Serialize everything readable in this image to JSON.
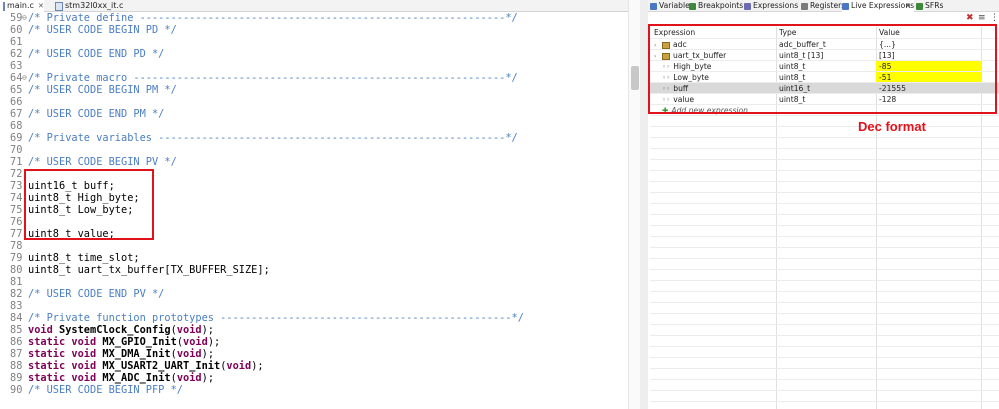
{
  "editor": {
    "tabs": [
      {
        "label": "main.c"
      },
      {
        "label": "stm32l0xx_it.c"
      }
    ],
    "lines": [
      {
        "n": "59",
        "fold": "⊖",
        "parts": [
          [
            "c",
            "/* Private define -----------------------------------------------------------*/"
          ]
        ]
      },
      {
        "n": "60",
        "fold": "",
        "parts": [
          [
            "c",
            "/* USER CODE BEGIN PD */"
          ]
        ]
      },
      {
        "n": "61",
        "fold": "",
        "parts": []
      },
      {
        "n": "62",
        "fold": "",
        "parts": [
          [
            "c",
            "/* USER CODE END PD */"
          ]
        ]
      },
      {
        "n": "63",
        "fold": "",
        "parts": []
      },
      {
        "n": "64",
        "fold": "⊖",
        "parts": [
          [
            "c",
            "/* Private macro ------------------------------------------------------------*/"
          ]
        ]
      },
      {
        "n": "65",
        "fold": "",
        "parts": [
          [
            "c",
            "/* USER CODE BEGIN PM */"
          ]
        ]
      },
      {
        "n": "66",
        "fold": "",
        "parts": []
      },
      {
        "n": "67",
        "fold": "",
        "parts": [
          [
            "c",
            "/* USER CODE END PM */"
          ]
        ]
      },
      {
        "n": "68",
        "fold": "",
        "parts": []
      },
      {
        "n": "69",
        "fold": "",
        "parts": [
          [
            "c",
            "/* Private variables --------------------------------------------------------*/"
          ]
        ]
      },
      {
        "n": "70",
        "fold": "",
        "parts": []
      },
      {
        "n": "71",
        "fold": "",
        "parts": [
          [
            "c",
            "/* USER CODE BEGIN PV */"
          ]
        ]
      },
      {
        "n": "72",
        "fold": "",
        "parts": []
      },
      {
        "n": "73",
        "fold": "",
        "parts": [
          [
            "t",
            "uint16_t buff;"
          ]
        ]
      },
      {
        "n": "74",
        "fold": "",
        "parts": [
          [
            "t",
            "uint8_t High_byte;"
          ]
        ]
      },
      {
        "n": "75",
        "fold": "",
        "parts": [
          [
            "t",
            "uint8_t Low_byte;"
          ]
        ]
      },
      {
        "n": "76",
        "fold": "",
        "parts": []
      },
      {
        "n": "77",
        "fold": "",
        "parts": [
          [
            "t",
            "uint8_t value;"
          ]
        ]
      },
      {
        "n": "78",
        "fold": "",
        "parts": []
      },
      {
        "n": "79",
        "fold": "",
        "parts": [
          [
            "t",
            "uint8_t time_slot;"
          ]
        ]
      },
      {
        "n": "80",
        "fold": "",
        "parts": [
          [
            "t",
            "uint8_t uart_tx_buffer[TX_BUFFER_SIZE];"
          ]
        ]
      },
      {
        "n": "81",
        "fold": "",
        "parts": []
      },
      {
        "n": "82",
        "fold": "",
        "parts": [
          [
            "c",
            "/* USER CODE END PV */"
          ]
        ]
      },
      {
        "n": "83",
        "fold": "",
        "parts": []
      },
      {
        "n": "84",
        "fold": "",
        "parts": [
          [
            "c",
            "/* Private function prototypes -----------------------------------------------*/"
          ]
        ]
      },
      {
        "n": "85",
        "fold": "",
        "parts": [
          [
            "k",
            "void "
          ],
          [
            "b",
            "SystemClock_Config"
          ],
          [
            "t",
            "("
          ],
          [
            "k",
            "void"
          ],
          [
            "t",
            ");"
          ]
        ]
      },
      {
        "n": "86",
        "fold": "",
        "parts": [
          [
            "k",
            "static void "
          ],
          [
            "b",
            "MX_GPIO_Init"
          ],
          [
            "t",
            "("
          ],
          [
            "k",
            "void"
          ],
          [
            "t",
            ");"
          ]
        ]
      },
      {
        "n": "87",
        "fold": "",
        "parts": [
          [
            "k",
            "static void "
          ],
          [
            "b",
            "MX_DMA_Init"
          ],
          [
            "t",
            "("
          ],
          [
            "k",
            "void"
          ],
          [
            "t",
            ");"
          ]
        ]
      },
      {
        "n": "88",
        "fold": "",
        "parts": [
          [
            "k",
            "static void "
          ],
          [
            "b",
            "MX_USART2_UART_Init"
          ],
          [
            "t",
            "("
          ],
          [
            "k",
            "void"
          ],
          [
            "t",
            ");"
          ]
        ]
      },
      {
        "n": "89",
        "fold": "",
        "parts": [
          [
            "k",
            "static void "
          ],
          [
            "b",
            "MX_ADC_Init"
          ],
          [
            "t",
            "("
          ],
          [
            "k",
            "void"
          ],
          [
            "t",
            ");"
          ]
        ]
      },
      {
        "n": "90",
        "fold": "",
        "parts": [
          [
            "c",
            "/* USER CODE BEGIN PFP */"
          ]
        ]
      }
    ]
  },
  "debug": {
    "tabs": [
      {
        "label": "Variables",
        "icon": "variables-icon",
        "color": "#4a78c0"
      },
      {
        "label": "Breakpoints",
        "icon": "breakpoints-icon",
        "color": "#3b8a3b"
      },
      {
        "label": "Expressions",
        "icon": "expressions-icon",
        "color": "#6b6bb0"
      },
      {
        "label": "Registers",
        "icon": "registers-icon",
        "color": "#7a7a7a"
      },
      {
        "label": "Live Expressions",
        "icon": "live-expressions-icon",
        "color": "#4a78c0"
      },
      {
        "label": "SFRs",
        "icon": "sfrs-icon",
        "color": "#3b8a3b"
      }
    ],
    "toolbar": {
      "delete_all": "✖",
      "collapse": "≡",
      "menu": "⋮"
    },
    "columns": {
      "expression": "Expression",
      "type": "Type",
      "value": "Value"
    },
    "rows": [
      {
        "expr": "adc",
        "type": "adc_buffer_t",
        "value": "{...}",
        "kind": "struct",
        "highlight": false,
        "selected": false
      },
      {
        "expr": "uart_tx_buffer",
        "type": "uint8_t [13]",
        "value": "[13]",
        "kind": "struct",
        "highlight": false,
        "selected": false
      },
      {
        "expr": "High_byte",
        "type": "uint8_t",
        "value": "-85",
        "kind": "var",
        "highlight": true,
        "selected": false
      },
      {
        "expr": "Low_byte",
        "type": "uint8_t",
        "value": "-51",
        "kind": "var",
        "highlight": true,
        "selected": false
      },
      {
        "expr": "buff",
        "type": "uint16_t",
        "value": "-21555",
        "kind": "var",
        "highlight": false,
        "selected": true
      },
      {
        "expr": "value",
        "type": "uint8_t",
        "value": "-128",
        "kind": "var",
        "highlight": false,
        "selected": false
      }
    ],
    "add_expression": "Add new expression"
  },
  "annotation": {
    "label": "Dec format",
    "color": "#e0121b"
  },
  "colors": {
    "comment": "#4a7ec2",
    "keyword": "#7f0055",
    "highlight": "#ffff00",
    "selected_row": "#d9d9d9"
  }
}
